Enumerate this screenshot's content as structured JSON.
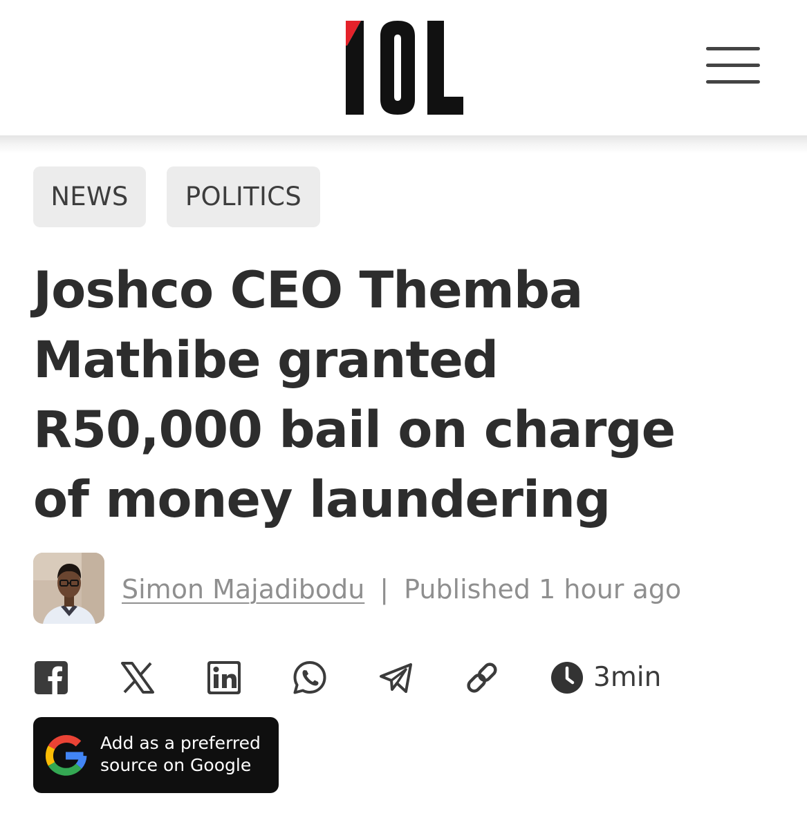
{
  "header": {
    "logo_text": "IOL",
    "menu_icon": "hamburger-menu-icon"
  },
  "tags": [
    "NEWS",
    "POLITICS"
  ],
  "article": {
    "headline_lines": [
      "Joshco CEO Themba",
      "Mathibe granted",
      "R50,000 bail on charge",
      "of money laundering"
    ],
    "author": "Simon Majadibodu",
    "separator": "|",
    "published": "Published 1 hour ago",
    "read_time": "3min"
  },
  "share": {
    "icons": [
      "facebook-icon",
      "x-icon",
      "linkedin-icon",
      "whatsapp-icon",
      "telegram-icon",
      "link-icon"
    ]
  },
  "google_cta": {
    "line1": "Add as a preferred",
    "line2": "source on Google"
  },
  "colors": {
    "brand_red": "#e4222a",
    "logo_black": "#111111",
    "text_dark": "#2d2d2d",
    "text_muted": "#8f8f8f",
    "tag_bg": "#ececec"
  }
}
